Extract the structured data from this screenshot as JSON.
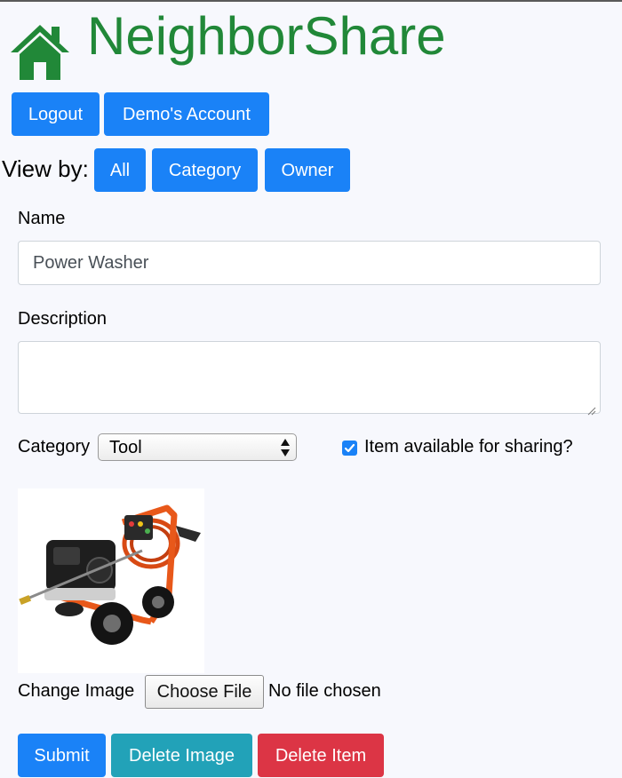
{
  "app": {
    "title": "NeighborShare",
    "brand_color": "#218838"
  },
  "account_nav": {
    "logout_label": "Logout",
    "account_label": "Demo's Account"
  },
  "view_by": {
    "label": "View by:",
    "options": [
      "All",
      "Category",
      "Owner"
    ]
  },
  "form": {
    "name_label": "Name",
    "name_value": "Power Washer",
    "description_label": "Description",
    "description_value": "",
    "category_label": "Category",
    "category_selected": "Tool",
    "sharing_label": "Item available for sharing?",
    "sharing_checked": true,
    "item_image_icon": "pressure-washer-photo",
    "change_image_label": "Change Image",
    "choose_file_label": "Choose File",
    "file_status": "No file chosen"
  },
  "actions": {
    "submit_label": "Submit",
    "delete_image_label": "Delete Image",
    "delete_item_label": "Delete Item"
  },
  "colors": {
    "primary": "#1a82f7",
    "info": "#22a2b8",
    "danger": "#dc3545"
  }
}
